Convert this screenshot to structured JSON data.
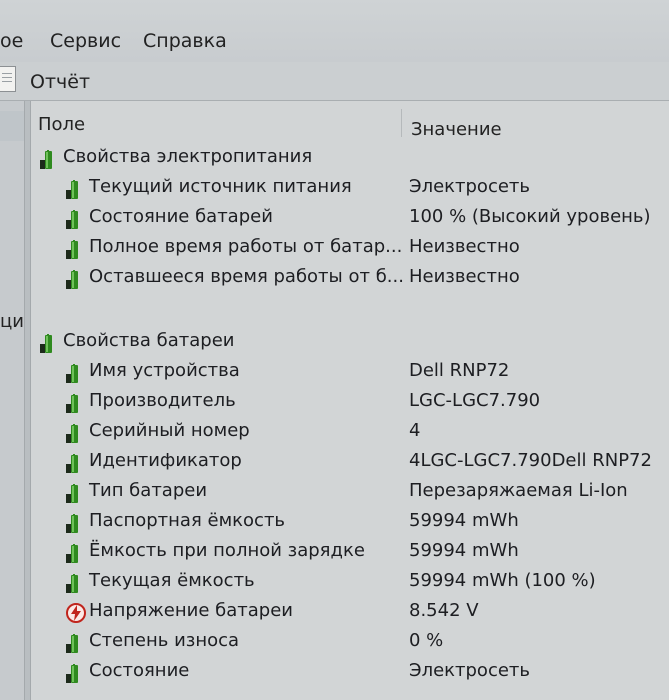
{
  "menu": {
    "items": [
      "ое",
      "Сервис",
      "Справка"
    ]
  },
  "toolbar": {
    "report_label": "Отчёт"
  },
  "left_pane": {
    "partial_text": "ци"
  },
  "table": {
    "col_field": "Поле",
    "col_value": "Значение"
  },
  "groups": [
    {
      "label": "Свойства электропитания",
      "icon": "battery-icon",
      "rows": [
        {
          "label": "Текущий источник питания",
          "value": "Электросеть",
          "icon": "battery-icon"
        },
        {
          "label": "Состояние батарей",
          "value": "100 % (Высокий уровень)",
          "icon": "battery-icon"
        },
        {
          "label": "Полное время работы от батар...",
          "value": "Неизвестно",
          "icon": "battery-icon"
        },
        {
          "label": "Оставшееся время работы от б...",
          "value": "Неизвестно",
          "icon": "battery-icon"
        }
      ]
    },
    {
      "label": "Свойства батареи",
      "icon": "battery-icon",
      "rows": [
        {
          "label": "Имя устройства",
          "value": "Dell RNP72",
          "icon": "battery-icon"
        },
        {
          "label": "Производитель",
          "value": "LGC-LGC7.790",
          "icon": "battery-icon"
        },
        {
          "label": "Серийный номер",
          "value": "4",
          "icon": "battery-icon"
        },
        {
          "label": "Идентификатор",
          "value": "4LGC-LGC7.790Dell RNP72",
          "icon": "battery-icon"
        },
        {
          "label": "Тип батареи",
          "value": "Перезаряжаемая Li-Ion",
          "icon": "battery-icon"
        },
        {
          "label": "Паспортная ёмкость",
          "value": "59994 mWh",
          "icon": "battery-icon"
        },
        {
          "label": "Ёмкость при полной зарядке",
          "value": "59994 mWh",
          "icon": "battery-icon"
        },
        {
          "label": "Текущая ёмкость",
          "value": "59994 mWh  (100 %)",
          "icon": "battery-icon"
        },
        {
          "label": "Напряжение батареи",
          "value": "8.542 V",
          "icon": "voltage-icon"
        },
        {
          "label": "Степень износа",
          "value": "0 %",
          "icon": "battery-icon"
        },
        {
          "label": "Состояние",
          "value": "Электросеть",
          "icon": "battery-icon"
        }
      ]
    }
  ],
  "colors": {
    "battery_green": "#2f8a1f",
    "battery_dark": "#1d2a1b",
    "voltage_red": "#c0241c"
  }
}
